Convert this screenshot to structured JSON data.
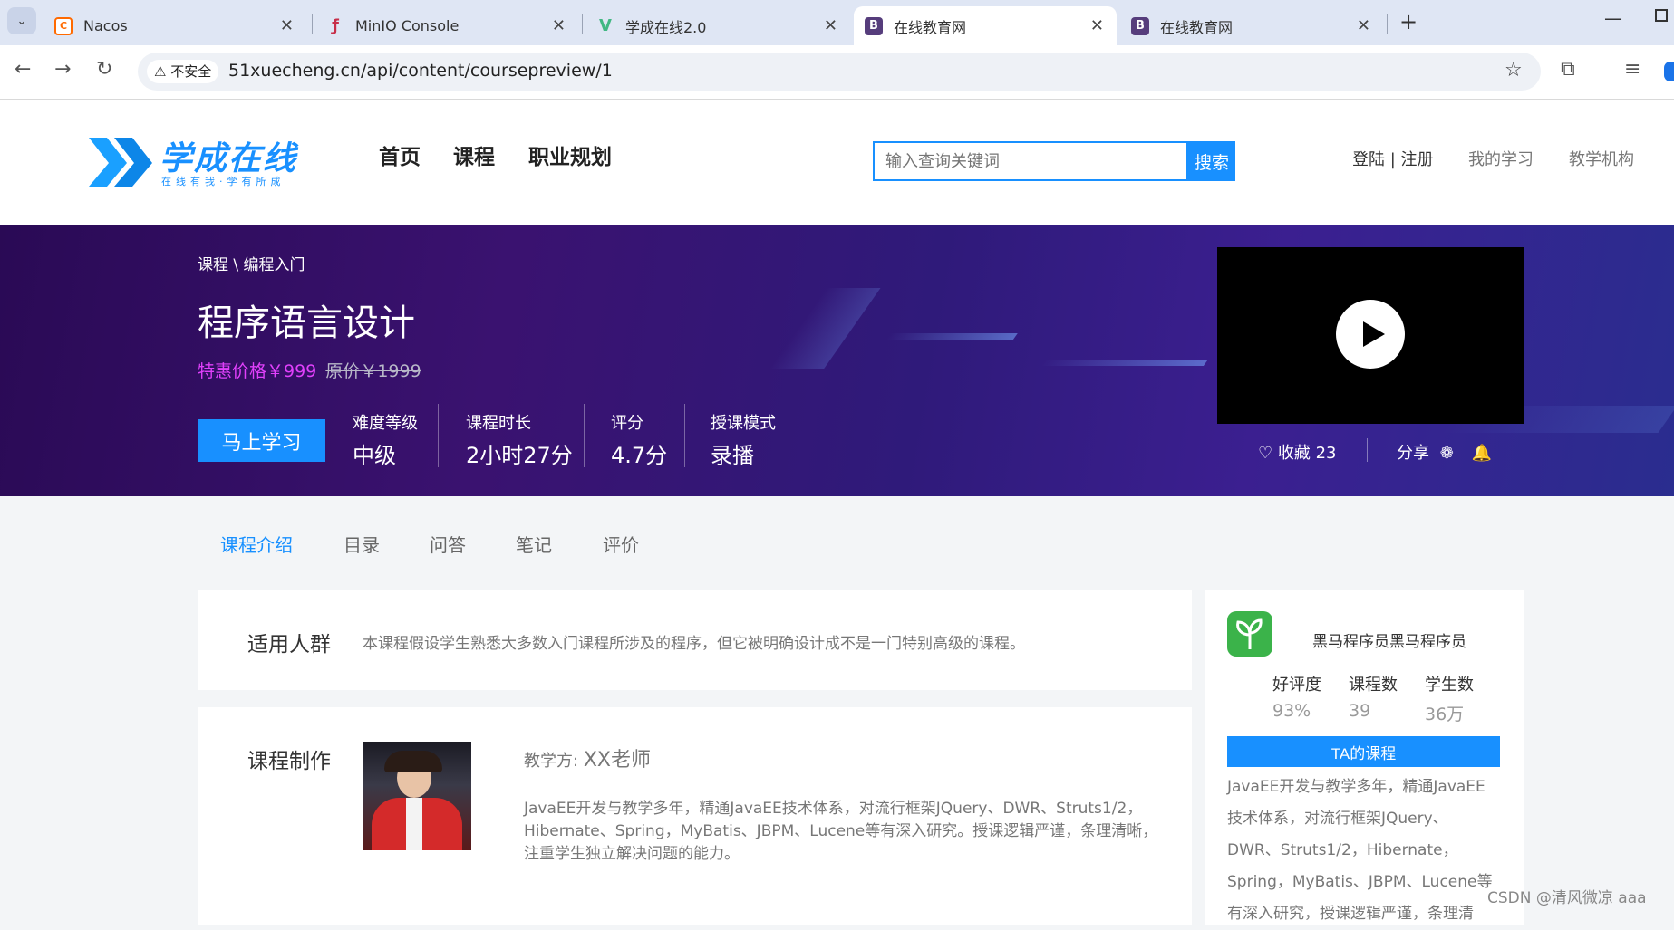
{
  "browser": {
    "tabs": [
      {
        "title": "Nacos",
        "icon": "nacos-icon"
      },
      {
        "title": "MinIO Console",
        "icon": "minio-icon"
      },
      {
        "title": "学成在线2.0",
        "icon": "vue-icon"
      },
      {
        "title": "在线教育网",
        "icon": "bootstrap-icon"
      },
      {
        "title": "在线教育网",
        "icon": "bootstrap-icon"
      }
    ],
    "security_label": "不安全",
    "url": "51xuecheng.cn/api/content/coursepreview/1"
  },
  "site": {
    "logo_text": "学成在线",
    "logo_slogan": "在线有我·学有所成",
    "nav": [
      "首页",
      "课程",
      "职业规划"
    ],
    "search_placeholder": "输入查询关键词",
    "search_button": "搜索",
    "login_register": "登陆 | 注册",
    "my_study": "我的学习",
    "institution": "教学机构"
  },
  "course": {
    "breadcrumb": "课程 \\ 编程入门",
    "title": "程序语言设计",
    "price_label": "特惠价格￥999",
    "original_price": "原价￥1999",
    "cta": "马上学习",
    "stats": [
      {
        "label": "难度等级",
        "value": "中级"
      },
      {
        "label": "课程时长",
        "value": "2小时27分"
      },
      {
        "label": "评分",
        "value": "4.7分"
      },
      {
        "label": "授课模式",
        "value": "录播"
      }
    ],
    "favorite": "收藏 23",
    "share": "分享"
  },
  "course_tabs": [
    "课程介绍",
    "目录",
    "问答",
    "笔记",
    "评价"
  ],
  "audience": {
    "heading": "适用人群",
    "text": "本课程假设学生熟悉大多数入门课程所涉及的程序，但它被明确设计成不是一门特别高级的课程。"
  },
  "production": {
    "heading": "课程制作",
    "teacher_label": "教学方:",
    "teacher_name": "XX老师",
    "bio_lines": [
      "JavaEE开发与教学多年，精通JavaEE技术体系，对流行框架JQuery、DWR、Struts1/2，",
      "Hibernate、Spring，MyBatis、JBPM、Lucene等有深入研究。授课逻辑严谨，条理清晰，",
      "注重学生独立解决问题的能力。"
    ]
  },
  "teacher_card": {
    "name": "黑马程序员黑马程序员",
    "metrics": [
      {
        "label": "好评度",
        "value": "93%"
      },
      {
        "label": "课程数",
        "value": "39"
      },
      {
        "label": "学生数",
        "value": "36万"
      }
    ],
    "courses_button": "TA的课程",
    "desc_lines": [
      "JavaEE开发与教学多年，精通JavaEE",
      "技术体系，对流行框架JQuery、",
      "DWR、Struts1/2，Hibernate，",
      "Spring，MyBatis、JBPM、Lucene等",
      "有深入研究，授课逻辑严谨，条理清"
    ]
  },
  "watermark": "CSDN @清风微凉 aaa",
  "colors": {
    "accent": "#1890ff",
    "price": "#e040fb",
    "banner": "#3a1270"
  }
}
